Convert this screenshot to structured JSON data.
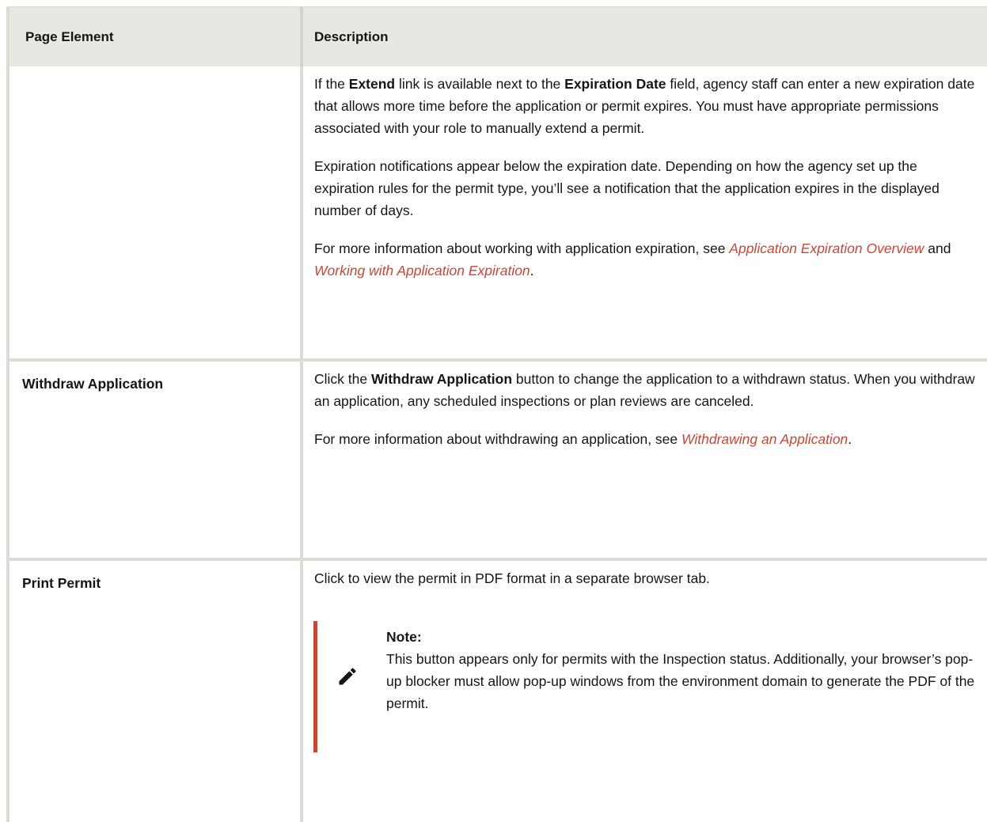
{
  "table": {
    "headers": {
      "page_element": "Page Element",
      "description": "Description"
    },
    "rows": [
      {
        "element": "",
        "paragraphs": {
          "p1": {
            "t1": "If the ",
            "b1": "Extend",
            "t2": " link is available next to the ",
            "b2": "Expiration Date",
            "t3": " field, agency staff can enter a new expiration date that allows more time before the application or permit expires. You must have appropriate permissions associated with your role to manually extend a permit."
          },
          "p2": "Expiration notifications appear below the expiration date. Depending on how the agency set up the expiration rules for the permit type, you’ll see a notification that the application expires in the displayed number of days.",
          "p3": {
            "t1": "For more information about working with application expiration, see ",
            "link1": "Application Expiration Overview",
            "t2": " and ",
            "link2": "Working with Application Expiration",
            "t3": "."
          }
        }
      },
      {
        "element": "Withdraw Application",
        "paragraphs": {
          "p1": {
            "t1": "Click the ",
            "b1": "Withdraw Application",
            "t2": " button to change the application to a withdrawn status. When you withdraw an application, any scheduled inspections or plan reviews are canceled."
          },
          "p2": {
            "t1": "For more information about withdrawing an application, see ",
            "link1": "Withdrawing an Application",
            "t2": "."
          }
        }
      },
      {
        "element": "Print Permit",
        "paragraphs": {
          "p1": "Click to view the permit in PDF format in a separate browser tab."
        },
        "note": {
          "title": "Note:",
          "text": "This button appears only for permits with the Inspection status. Additionally, your browser’s pop-up blocker must allow pop-up windows from the environment domain to generate the PDF of the permit.",
          "icon": "pencil-icon"
        }
      }
    ]
  },
  "colors": {
    "header_bg": "#e9e7e2",
    "link": "#c74634",
    "note_bar": "#c74634",
    "border": "#dedbd4"
  }
}
